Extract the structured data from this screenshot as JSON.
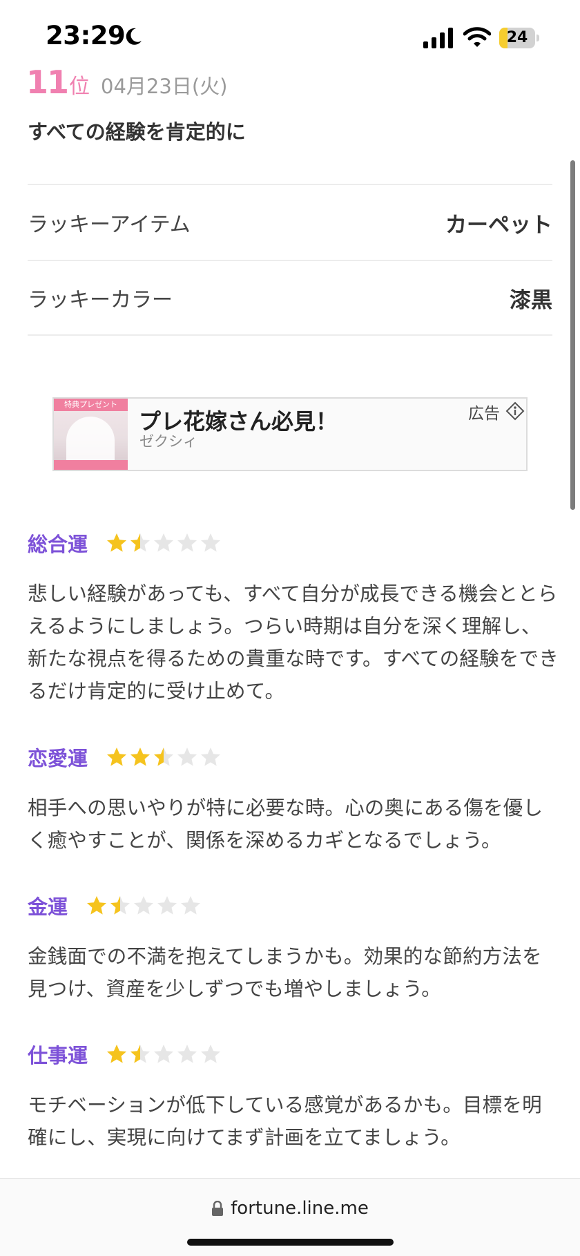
{
  "status_bar": {
    "time": "23:29",
    "icons": [
      "moon-icon",
      "cellular-signal-icon",
      "wifi-icon",
      "battery-icon"
    ],
    "battery_level": "24",
    "battery_fraction": 0.24
  },
  "header": {
    "rank_number": "11",
    "rank_suffix": "位",
    "date": "04月23日(火)",
    "headline": "すべての経験を肯定的に"
  },
  "lucky": [
    {
      "label": "ラッキーアイテム",
      "value": "カーペット"
    },
    {
      "label": "ラッキーカラー",
      "value": "漆黒"
    }
  ],
  "ad": {
    "image_tag": "特典プレゼント",
    "title": "プレ花嫁さん必見！",
    "advertiser": "ゼクシィ",
    "label": "広告",
    "icon": "info-icon"
  },
  "fortunes": [
    {
      "title": "総合運",
      "rating": 1.5,
      "max": 5,
      "text": "悲しい経験があっても、すべて自分が成長できる機会ととらえるようにしましょう。つらい時期は自分を深く理解し、新たな視点を得るための貴重な時です。すべての経験をできるだけ肯定的に受け止めて。"
    },
    {
      "title": "恋愛運",
      "rating": 2.5,
      "max": 5,
      "text": "相手への思いやりが特に必要な時。心の奥にある傷を優しく癒やすことが、関係を深めるカギとなるでしょう。"
    },
    {
      "title": "金運",
      "rating": 1.5,
      "max": 5,
      "text": "金銭面での不満を抱えてしまうかも。効果的な節約方法を見つけ、資産を少しずつでも増やしましょう。"
    },
    {
      "title": "仕事運",
      "rating": 1.5,
      "max": 5,
      "text": "モチベーションが低下している感覚があるかも。目標を明確にし、実現に向けてまず計画を立てましょう。"
    }
  ],
  "colors": {
    "rank_pink": "#f080b0",
    "section_purple": "#7d52d8",
    "star_gold": "#f5c31e",
    "star_empty": "#e6e6e6"
  },
  "browser": {
    "url": "fortune.line.me",
    "icon": "lock-icon"
  }
}
